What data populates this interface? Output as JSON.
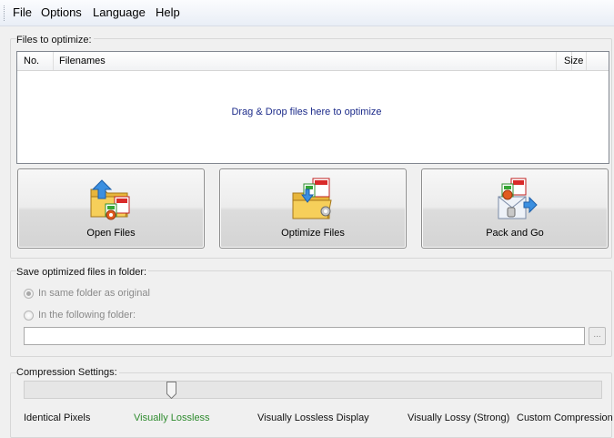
{
  "menu": {
    "items": [
      {
        "label": "File"
      },
      {
        "label": "Options"
      },
      {
        "label": "Language"
      },
      {
        "label": "Help"
      }
    ]
  },
  "files_group": {
    "label": "Files to optimize:",
    "columns": [
      "No.",
      "Filenames",
      "Size"
    ],
    "drop_hint": "Drag & Drop files here to optimize"
  },
  "actions": {
    "open_label": "Open Files",
    "optimize_label": "Optimize Files",
    "pack_label": "Pack and Go",
    "open_icon": "open-files-icon",
    "optimize_icon": "optimize-files-icon",
    "pack_icon": "pack-and-go-icon"
  },
  "save_group": {
    "label": "Save optimized files in folder:",
    "options": [
      {
        "label": "In same folder as original",
        "checked": true
      },
      {
        "label": "In the following folder:",
        "checked": false
      }
    ],
    "folder_value": "",
    "browse_label": "..."
  },
  "compression": {
    "label": "Compression Settings:",
    "levels": [
      {
        "label": "Identical Pixels"
      },
      {
        "label": "Visually Lossless"
      },
      {
        "label": "Visually Lossless Display"
      },
      {
        "label": "Visually Lossy (Strong)"
      },
      {
        "label": "Custom Compression"
      }
    ],
    "selected_level": "Visually Lossless",
    "active_color": "#2e8b2e"
  }
}
